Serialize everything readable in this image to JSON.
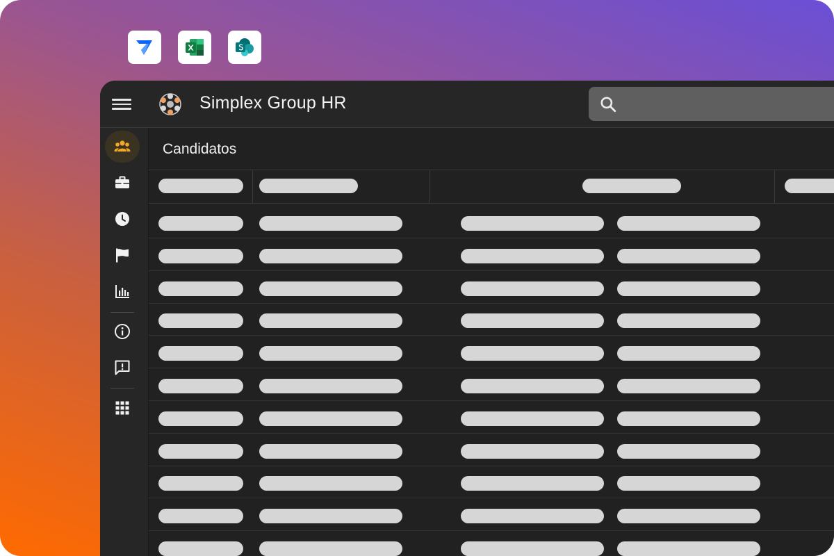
{
  "app": {
    "title": "Simplex Group HR"
  },
  "search": {
    "placeholder": ""
  },
  "page": {
    "title": "Candidatos"
  },
  "integrations": [
    {
      "name": "power-automate-icon"
    },
    {
      "name": "excel-icon"
    },
    {
      "name": "sharepoint-icon"
    }
  ],
  "sidebar": {
    "items": [
      {
        "icon": "people-icon",
        "active": true
      },
      {
        "icon": "briefcase-icon"
      },
      {
        "icon": "clock-icon"
      },
      {
        "icon": "flag-icon"
      },
      {
        "icon": "bar-chart-icon"
      },
      {
        "icon": "info-icon"
      },
      {
        "icon": "feedback-icon"
      },
      {
        "icon": "apps-grid-icon"
      }
    ]
  },
  "colors": {
    "accent": "#f5a623",
    "background": "#212121",
    "bar": "#d6d6d6"
  },
  "table": {
    "placeholder_rows": 11
  }
}
